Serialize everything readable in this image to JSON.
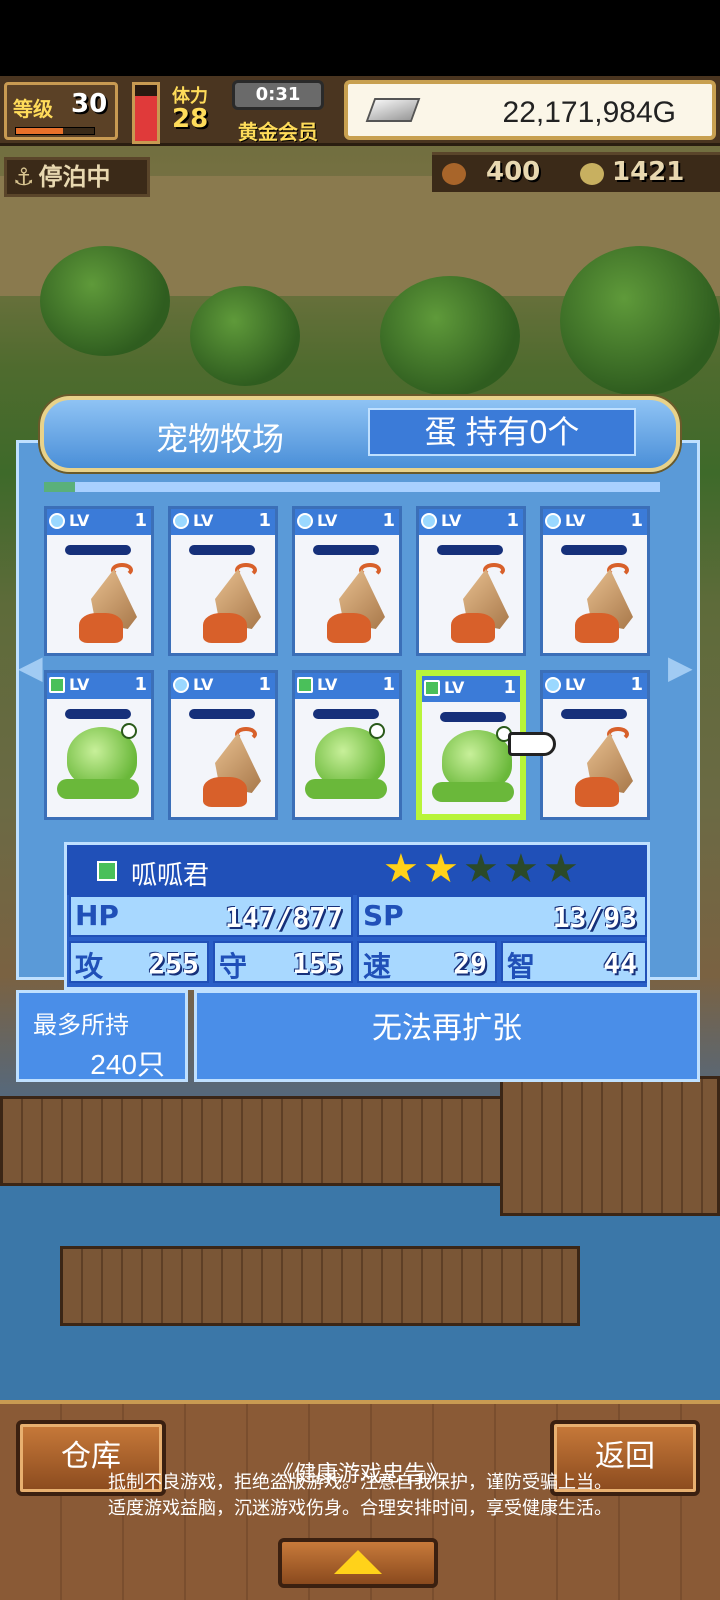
{
  "hud": {
    "level_label": "等级",
    "level_value": "30",
    "exp_progress": 0.6,
    "stamina_progress": 0.8,
    "body_label": "体力",
    "body_value": "28",
    "time": "0:31",
    "vip_label": "黄金会员",
    "money": "22,171,984G",
    "dock_status": "停泊中",
    "resource_1": "400",
    "resource_2": "1421"
  },
  "panel": {
    "title": "宠物牧场",
    "egg_status": "蛋 持有0个",
    "scroll_progress": 0.05
  },
  "pets": [
    {
      "type": "hermit-crab",
      "element": "water",
      "lv_label": "LV",
      "lv": "1"
    },
    {
      "type": "hermit-crab",
      "element": "water",
      "lv_label": "LV",
      "lv": "1"
    },
    {
      "type": "hermit-crab",
      "element": "water",
      "lv_label": "LV",
      "lv": "1"
    },
    {
      "type": "hermit-crab",
      "element": "water",
      "lv_label": "LV",
      "lv": "1"
    },
    {
      "type": "hermit-crab",
      "element": "water",
      "lv_label": "LV",
      "lv": "1"
    },
    {
      "type": "frog",
      "element": "nature",
      "lv_label": "LV",
      "lv": "1"
    },
    {
      "type": "hermit-crab",
      "element": "water",
      "lv_label": "LV",
      "lv": "1"
    },
    {
      "type": "frog",
      "element": "nature",
      "lv_label": "LV",
      "lv": "1"
    },
    {
      "type": "frog",
      "element": "nature",
      "lv_label": "LV",
      "lv": "1",
      "selected": true
    },
    {
      "type": "hermit-crab",
      "element": "water",
      "lv_label": "LV",
      "lv": "1"
    }
  ],
  "selected_pet": {
    "name": "呱呱君",
    "stars": 2,
    "max_stars": 5,
    "hp_label": "HP",
    "hp": "147/877",
    "sp_label": "SP",
    "sp": "13/93",
    "atk_label": "攻",
    "atk": "255",
    "def_label": "守",
    "def": "155",
    "spd_label": "速",
    "spd": "29",
    "int_label": "智",
    "int": "44"
  },
  "capacity": {
    "label": "最多所持",
    "value": "240只",
    "expand_text": "无法再扩张"
  },
  "bottom": {
    "warehouse_label": "仓库",
    "back_label": "返回",
    "warning_title": "《健康游戏忠告》",
    "warning_line1": "抵制不良游戏，拒绝盗版游戏。注意自我保护，谨防受骗上当。",
    "warning_line2": "适度游戏益脑，沉迷游戏伤身。合理安排时间，享受健康生活。"
  },
  "colors": {
    "panel_blue": "#5a9ad8",
    "selected_border": "#b8f43a",
    "star_gold": "#ffd21a"
  }
}
